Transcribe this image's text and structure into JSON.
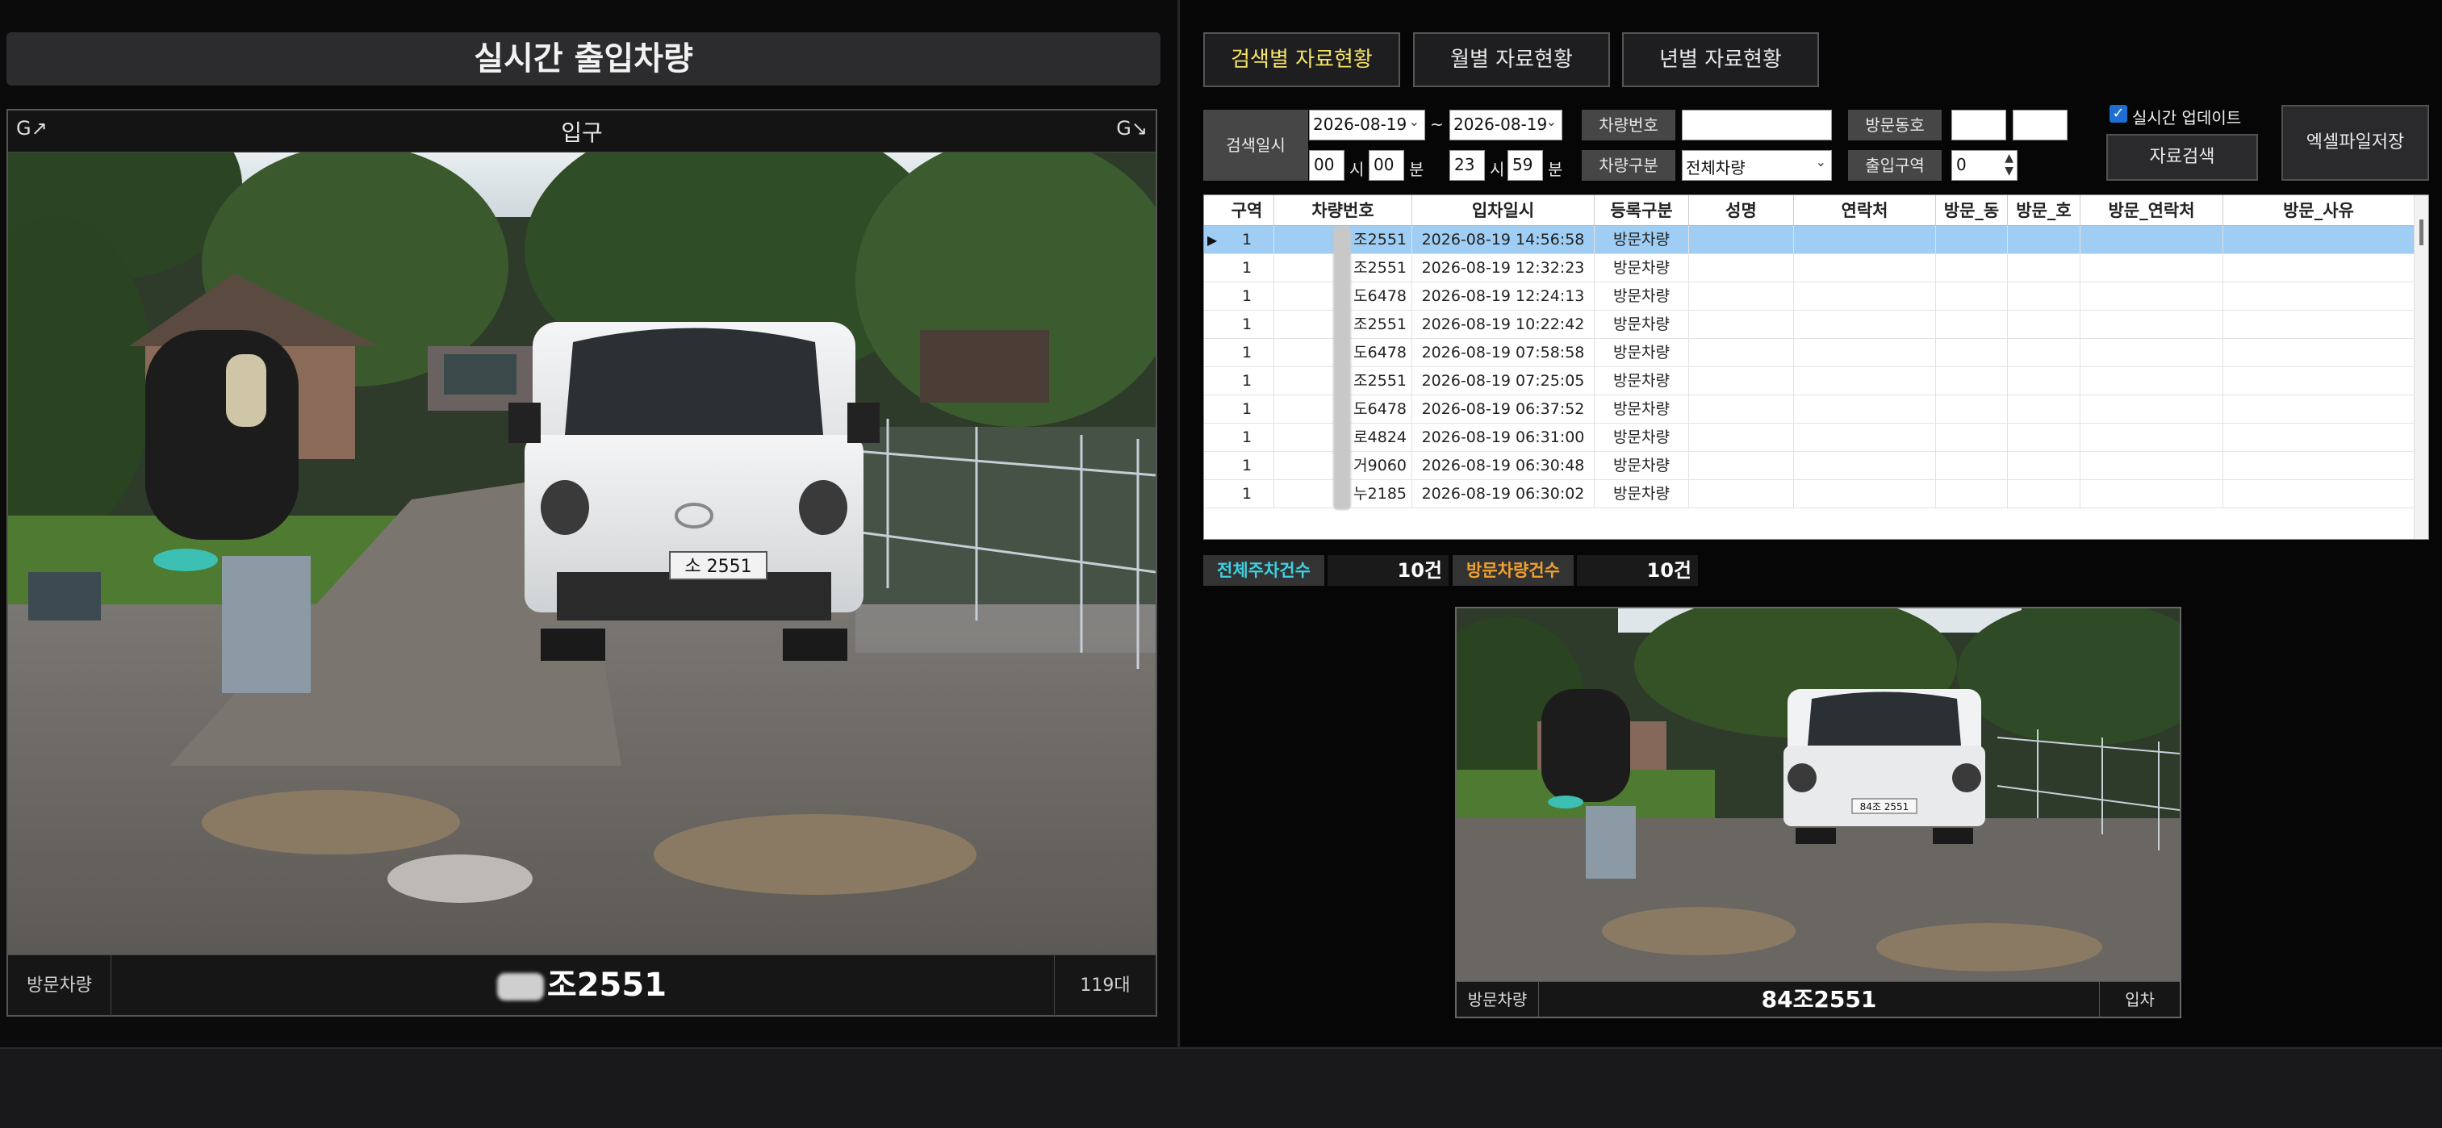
{
  "left": {
    "title": "실시간 출입차량",
    "camera": {
      "left_flag": "G↗",
      "label": "입구",
      "right_flag": "G↘",
      "footer_type": "방문차량",
      "footer_plate": "조2551",
      "footer_count": "119대",
      "van_plate_text": "소 2551"
    }
  },
  "tabs": [
    {
      "label": "검색별 자료현황"
    },
    {
      "label": "월별 자료현황"
    },
    {
      "label": "년별 자료현황"
    }
  ],
  "search": {
    "date_label": "검색일시",
    "start_date": "2026-08-19",
    "tilde": "~",
    "end_date": "2026-08-19",
    "start_hour": "00",
    "hour_unit": "시",
    "start_min": "00",
    "min_unit": "분",
    "end_hour": "23",
    "end_min": "59",
    "vehicle_no_label": "차량번호",
    "vehicle_no_value": "",
    "vehicle_type_label": "차량구분",
    "vehicle_type_value": "전체차량",
    "visit_dong_label": "방문동호",
    "visit_dong_value": "",
    "visit_ho_value": "",
    "zone_label": "출입구역",
    "zone_value": "0",
    "realtime_update_label": "실시간 업데이트",
    "realtime_update_checked": true,
    "search_button": "자료검색",
    "excel_button": "엑셀파일저장"
  },
  "table": {
    "columns": [
      "구역",
      "차량번호",
      "입차일시",
      "등록구분",
      "성명",
      "연락처",
      "방문_동",
      "방문_호",
      "방문_연락처",
      "방문_사유"
    ],
    "rows": [
      {
        "zone": "1",
        "plate": "조2551",
        "time": "2026-08-19 14:56:58",
        "type": "방문차량"
      },
      {
        "zone": "1",
        "plate": "조2551",
        "time": "2026-08-19 12:32:23",
        "type": "방문차량"
      },
      {
        "zone": "1",
        "plate": "도6478",
        "time": "2026-08-19 12:24:13",
        "type": "방문차량"
      },
      {
        "zone": "1",
        "plate": "조2551",
        "time": "2026-08-19 10:22:42",
        "type": "방문차량"
      },
      {
        "zone": "1",
        "plate": "도6478",
        "time": "2026-08-19 07:58:58",
        "type": "방문차량"
      },
      {
        "zone": "1",
        "plate": "조2551",
        "time": "2026-08-19 07:25:05",
        "type": "방문차량"
      },
      {
        "zone": "1",
        "plate": "도6478",
        "time": "2026-08-19 06:37:52",
        "type": "방문차량"
      },
      {
        "zone": "1",
        "plate": "로4824",
        "time": "2026-08-19 06:31:00",
        "type": "방문차량"
      },
      {
        "zone": "1",
        "plate": "거9060",
        "time": "2026-08-19 06:30:48",
        "type": "방문차량"
      },
      {
        "zone": "1",
        "plate": "누2185",
        "time": "2026-08-19 06:30:02",
        "type": "방문차량"
      }
    ]
  },
  "totals": {
    "all_label": "전체주차건수",
    "all_value": "10건",
    "visit_label": "방문차량건수",
    "visit_value": "10건"
  },
  "preview": {
    "type": "방문차량",
    "plate": "84조2551",
    "status": "입차",
    "van_plate_text": "84조 2551"
  },
  "colors": {
    "active_tab": "#f5e36a",
    "all_label": "#3fd0e0",
    "visit_label": "#f0a030",
    "selected_row": "#9fcdf3"
  }
}
